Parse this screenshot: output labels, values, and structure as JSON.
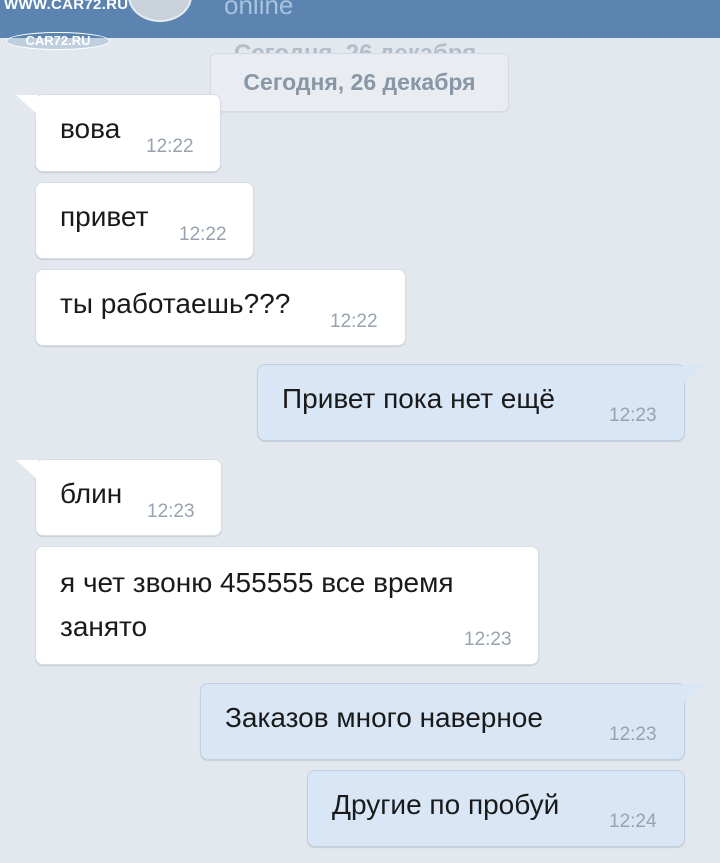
{
  "header": {
    "status": "online"
  },
  "watermark": {
    "top": "WWW.CAR72.RU",
    "bottom": "CAR72.RU"
  },
  "date_divider": {
    "label": "Сегодня, 26 декабря"
  },
  "messages": [
    {
      "direction": "in",
      "text": "вова",
      "time": "12:22"
    },
    {
      "direction": "in",
      "text": "привет",
      "time": "12:22"
    },
    {
      "direction": "in",
      "text": "ты работаешь???",
      "time": "12:22"
    },
    {
      "direction": "out",
      "text": "Привет пока нет ещё",
      "time": "12:23"
    },
    {
      "direction": "in",
      "text": "блин",
      "time": "12:23"
    },
    {
      "direction": "in",
      "text": "я чет звоню 455555 все время",
      "text2": "занято",
      "time": "12:23"
    },
    {
      "direction": "out",
      "text": "Заказов много наверное",
      "time": "12:23"
    },
    {
      "direction": "out",
      "text": "Другие по пробуй",
      "time": "12:24"
    }
  ],
  "colors": {
    "header": "#5b84b1",
    "background": "#e2e8ee",
    "incoming_bubble": "#ffffff",
    "outgoing_bubble": "#d8e6f5"
  }
}
